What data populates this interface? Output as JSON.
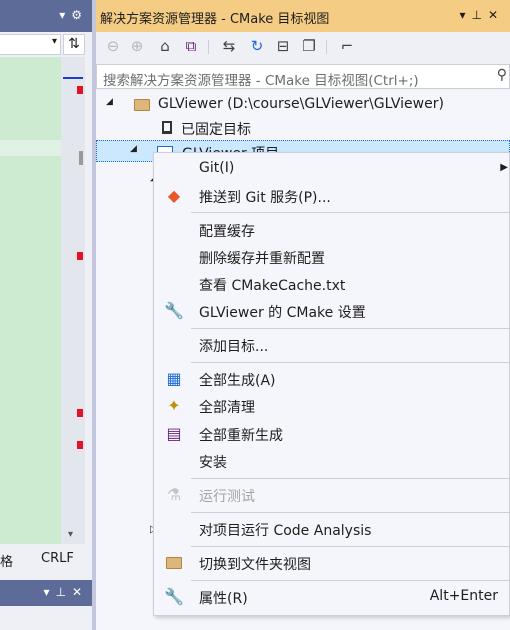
{
  "left_pane": {
    "status_encoding": "格",
    "status_line_ending": "CRLF"
  },
  "solution_explorer": {
    "title": "解决方案资源管理器 - CMake 目标视图",
    "search_placeholder": "搜索解决方案资源管理器 - CMake 目标视图(Ctrl+;)",
    "tree": {
      "root_label": "GLViewer (D:\\course\\GLViewer\\GLViewer)",
      "pinned_label": "已固定目标",
      "project_label": "GLViewer 项目"
    }
  },
  "context_menu": {
    "items": [
      {
        "label": "Git(I)"
      },
      {
        "label": "推送到 Git 服务(P)..."
      },
      {
        "label": "配置缓存"
      },
      {
        "label": "删除缓存并重新配置"
      },
      {
        "label": "查看 CMakeCache.txt"
      },
      {
        "label": "GLViewer 的 CMake 设置"
      },
      {
        "label": "添加目标..."
      },
      {
        "label": "全部生成(A)"
      },
      {
        "label": "全部清理"
      },
      {
        "label": "全部重新生成"
      },
      {
        "label": "安装"
      },
      {
        "label": "运行测试"
      },
      {
        "label": "对项目运行 Code Analysis"
      },
      {
        "label": "切换到文件夹视图"
      },
      {
        "label": "属性(R)",
        "shortcut": "Alt+Enter"
      }
    ]
  },
  "colors": {
    "title_accent": "#f5cc84",
    "panel_header": "#5d6b99",
    "editor_background": "#ccebd0",
    "error_marker": "#e81123"
  },
  "icons": [
    "dropdown-arrow-icon",
    "gear-icon",
    "split-icon",
    "back-icon",
    "forward-icon",
    "home-icon",
    "vs-switch-icon",
    "sync-icon",
    "refresh-icon",
    "collapse-all-icon",
    "show-all-files-icon",
    "properties-icon",
    "search-icon",
    "pin-icon",
    "close-icon",
    "folder-icon",
    "git-icon",
    "wrench-icon",
    "build-icon",
    "clean-icon",
    "rebuild-icon",
    "test-icon"
  ]
}
